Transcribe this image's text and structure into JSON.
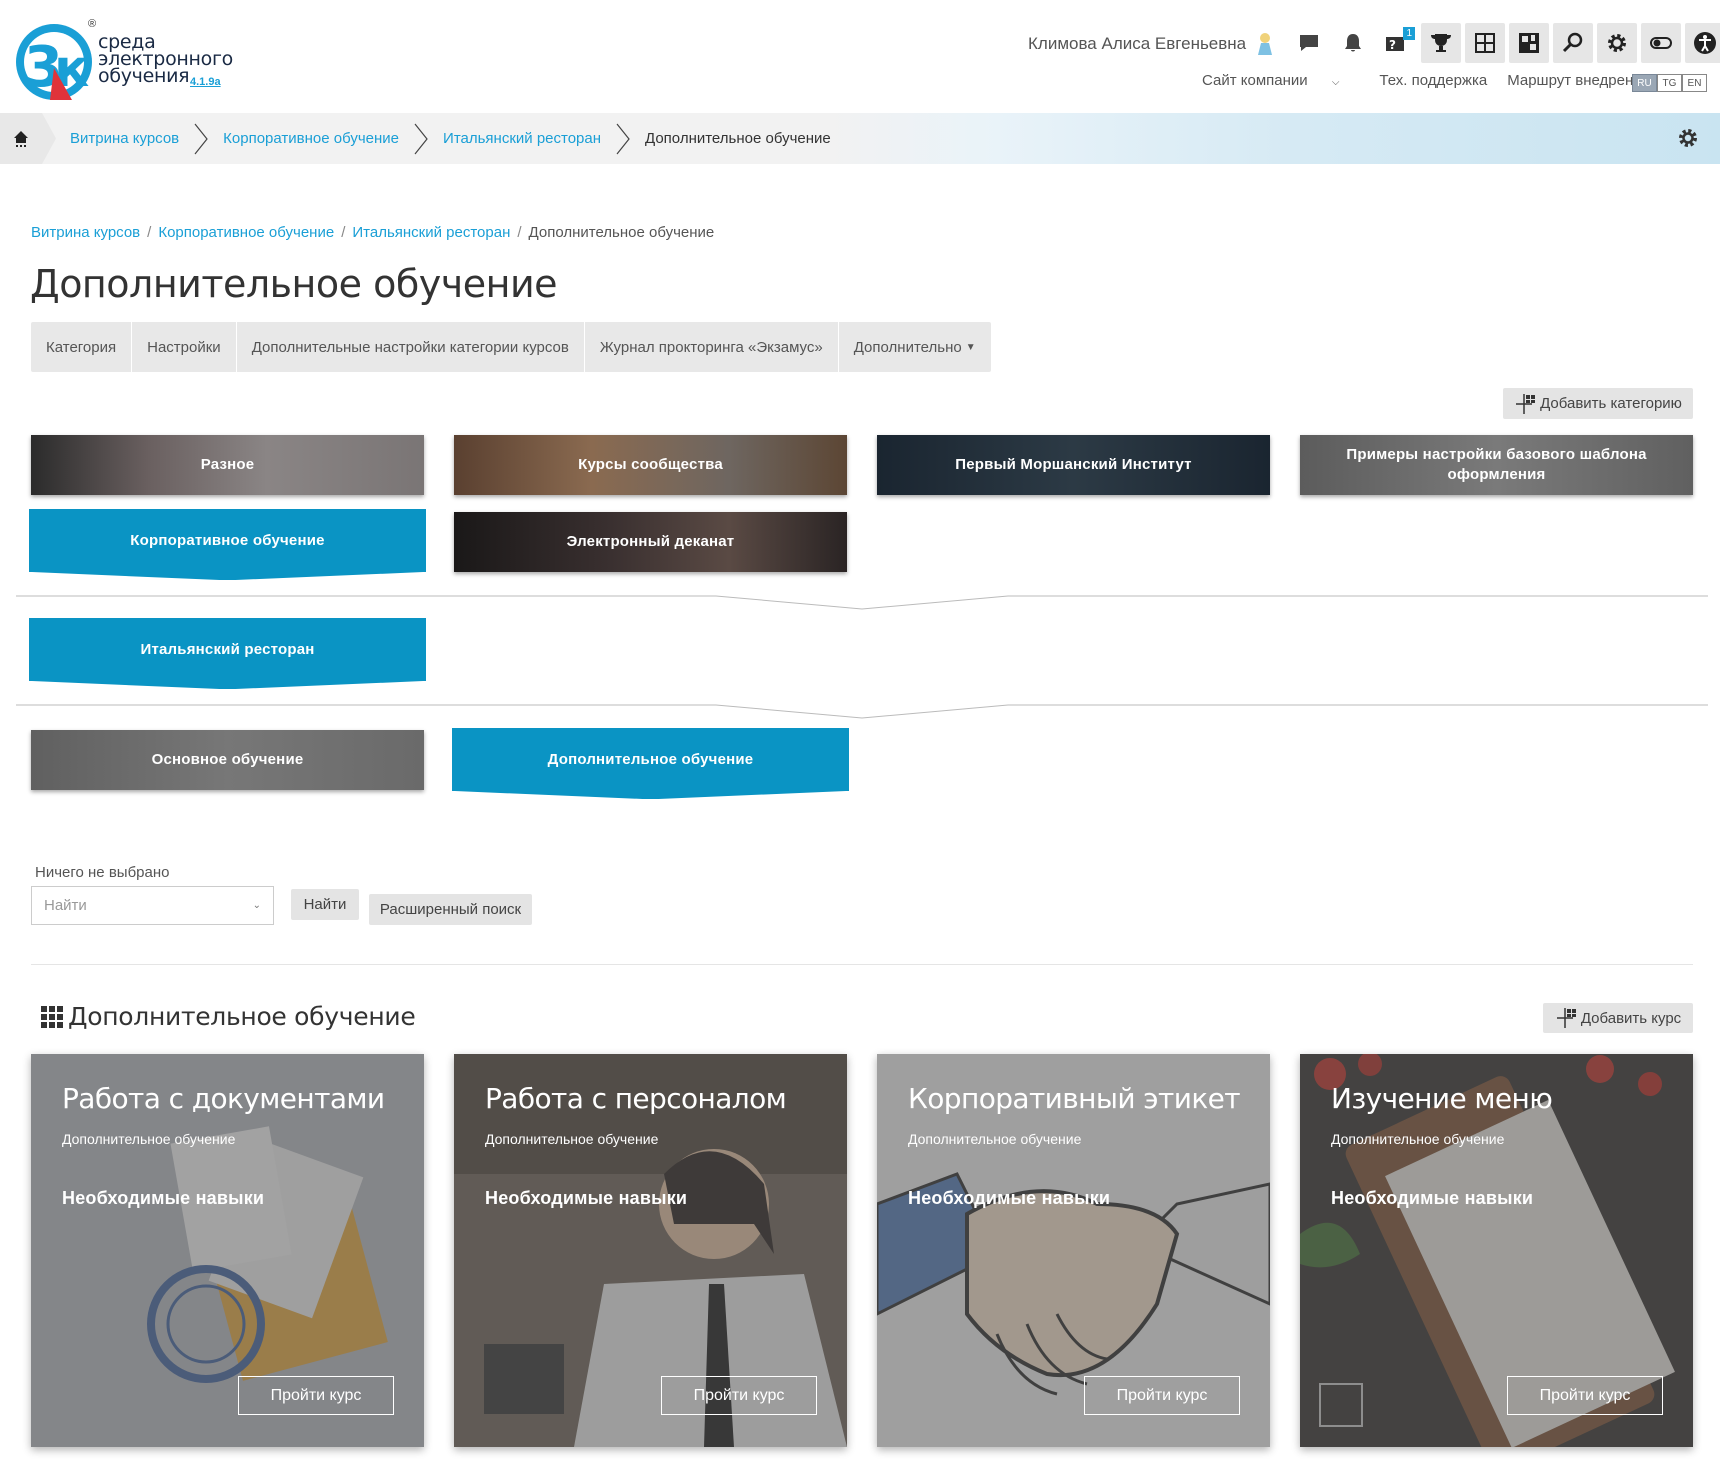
{
  "header": {
    "logo_text_line1": "среда",
    "logo_text_line2": "электронного",
    "logo_text_line3": "обучения",
    "logo_version": "4.1.9a",
    "logo_reg": "®",
    "user_name": "Климова Алиса Евгеньевна",
    "badge_count": "1",
    "links": {
      "company_site": "Сайт компании",
      "support": "Тех. поддержка",
      "roadmap": "Маршрут внедрения"
    },
    "languages": [
      "RU",
      "TG",
      "EN"
    ],
    "active_language": "RU"
  },
  "breadcrumb_bar": {
    "items": [
      "Витрина курсов",
      "Корпоративное обучение",
      "Итальянский ресторан",
      "Дополнительное обучение"
    ]
  },
  "breadcrumb": {
    "items": [
      "Витрина курсов",
      "Корпоративное обучение",
      "Итальянский ресторан",
      "Дополнительное обучение"
    ],
    "separator": "/"
  },
  "page_title": "Дополнительное обучение",
  "tabs": [
    "Категория",
    "Настройки",
    "Дополнительные настройки категории курсов",
    "Журнал прокторинга «Экзамус»",
    "Дополнительно"
  ],
  "add_category_label": "Добавить категорию",
  "categories": {
    "row1": [
      "Разное",
      "Курсы сообщества",
      "Первый Моршанский Институт",
      "Примеры настройки базового шаблона оформления"
    ],
    "row2": [
      "Корпоративное обучение",
      "Электронный деканат"
    ],
    "row3": [
      "Итальянский ресторан"
    ],
    "row4": [
      "Основное обучение",
      "Дополнительное обучение"
    ]
  },
  "search": {
    "label": "Ничего не выбрано",
    "placeholder": "Найти",
    "find_button": "Найти",
    "advanced_button": "Расширенный поиск"
  },
  "courses_section": {
    "title": "Дополнительное обучение",
    "add_course_label": "Добавить курс",
    "courses": [
      {
        "title": "Работа с документами",
        "category": "Дополнительное обучение",
        "skills": "Необходимые навыки",
        "button": "Пройти курс"
      },
      {
        "title": "Работа с персоналом",
        "category": "Дополнительное обучение",
        "skills": "Необходимые навыки",
        "button": "Пройти курс"
      },
      {
        "title": "Корпоративный этикет",
        "category": "Дополнительное обучение",
        "skills": "Необходимые навыки",
        "button": "Пройти курс"
      },
      {
        "title": "Изучение меню",
        "category": "Дополнительное обучение",
        "skills": "Необходимые навыки",
        "button": "Пройти курс"
      }
    ]
  },
  "colors": {
    "accent": "#1a9fd6",
    "category_active": "#0a94c4"
  }
}
